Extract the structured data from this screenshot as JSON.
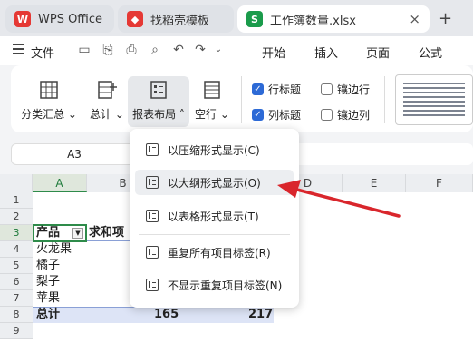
{
  "tabs": [
    {
      "label": "WPS Office",
      "icon": "wps-logo-icon"
    },
    {
      "label": "找稻壳模板",
      "icon": "docer-logo-icon"
    },
    {
      "label": "工作簿数量.xlsx",
      "icon": "spreadsheet-s-icon",
      "badge": "S"
    }
  ],
  "menu": {
    "file": "文件",
    "start": "开始",
    "insert": "插入",
    "page": "页面",
    "formula": "公式"
  },
  "ribbon": {
    "subtotal_group": "分类汇总",
    "total": "总计",
    "report_layout": "报表布局",
    "blank_row": "空行",
    "row_header": "行标题",
    "col_header": "列标题",
    "banded_rows": "镶边行",
    "banded_cols": "镶边列",
    "row_header_checked": true,
    "col_header_checked": true
  },
  "name_box": "A3",
  "columns": [
    "A",
    "B",
    "C",
    "D",
    "E",
    "F"
  ],
  "rows": [
    "1",
    "2",
    "3",
    "4",
    "5",
    "6",
    "7",
    "8",
    "9"
  ],
  "cells": {
    "a3": "产品",
    "b3": "求和项",
    "a4": "火龙果",
    "a5": "橘子",
    "a6": "梨子",
    "a7": "苹果",
    "a8": "总计",
    "b8": "165",
    "c8": "217"
  },
  "dropdown": [
    "以压缩形式显示(C)",
    "以大纲形式显示(O)",
    "以表格形式显示(T)",
    "重复所有项目标签(R)",
    "不显示重复项目标签(N)"
  ],
  "colors": {
    "accent": "#2d6ad6",
    "highlight_row": "#dde4f6",
    "arrow": "#d9262c",
    "tab_bg": "#e6e8ec"
  }
}
